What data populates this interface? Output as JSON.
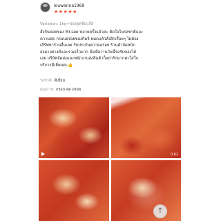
{
  "reviewer": {
    "name": "louwanna1969",
    "rating_text": "★★★★★",
    "rating": 5
  },
  "variation": "Variation: 1kg+ของดูดซับแก๊ส",
  "review_lines": [
    "สั่งกินบ่อยของ Mr.Lee หลายครั้งแล้วค่ะ ติดใจในรสชาติและ",
    "ความสด กรอบอร่อยของกิมจิ หมดแล้วสั่งอีกเรื่อยๆ ไม่ต้อง",
    "เสิร์ฟหาร้านอื่นเลย รับประกันความอร่อย ร้านค้าจัดหนัก",
    "ส่งมาอย่างดีและรวดเร็วมาก สั่งเมื่อวานวันนี้รอรับของได้",
    "เลย บริษัทจัดส่งและพนักงานส่งสินค้าก็อย่ารักมากค่ะใส่ใจ",
    "บริการดีเยี่ยมค่ะ"
  ],
  "thumb_emoji": "👍",
  "attributes": [
    {
      "label": "รสชาติ:",
      "value": "ดีเยี่ยม"
    },
    {
      "label": "คุณภาพ:",
      "value": "กรอบ สด อร่อย"
    }
  ],
  "media": {
    "video_duration": "0:01"
  },
  "scroll_top_icon": "↑",
  "colors": {
    "star": "#ee4d2d"
  }
}
